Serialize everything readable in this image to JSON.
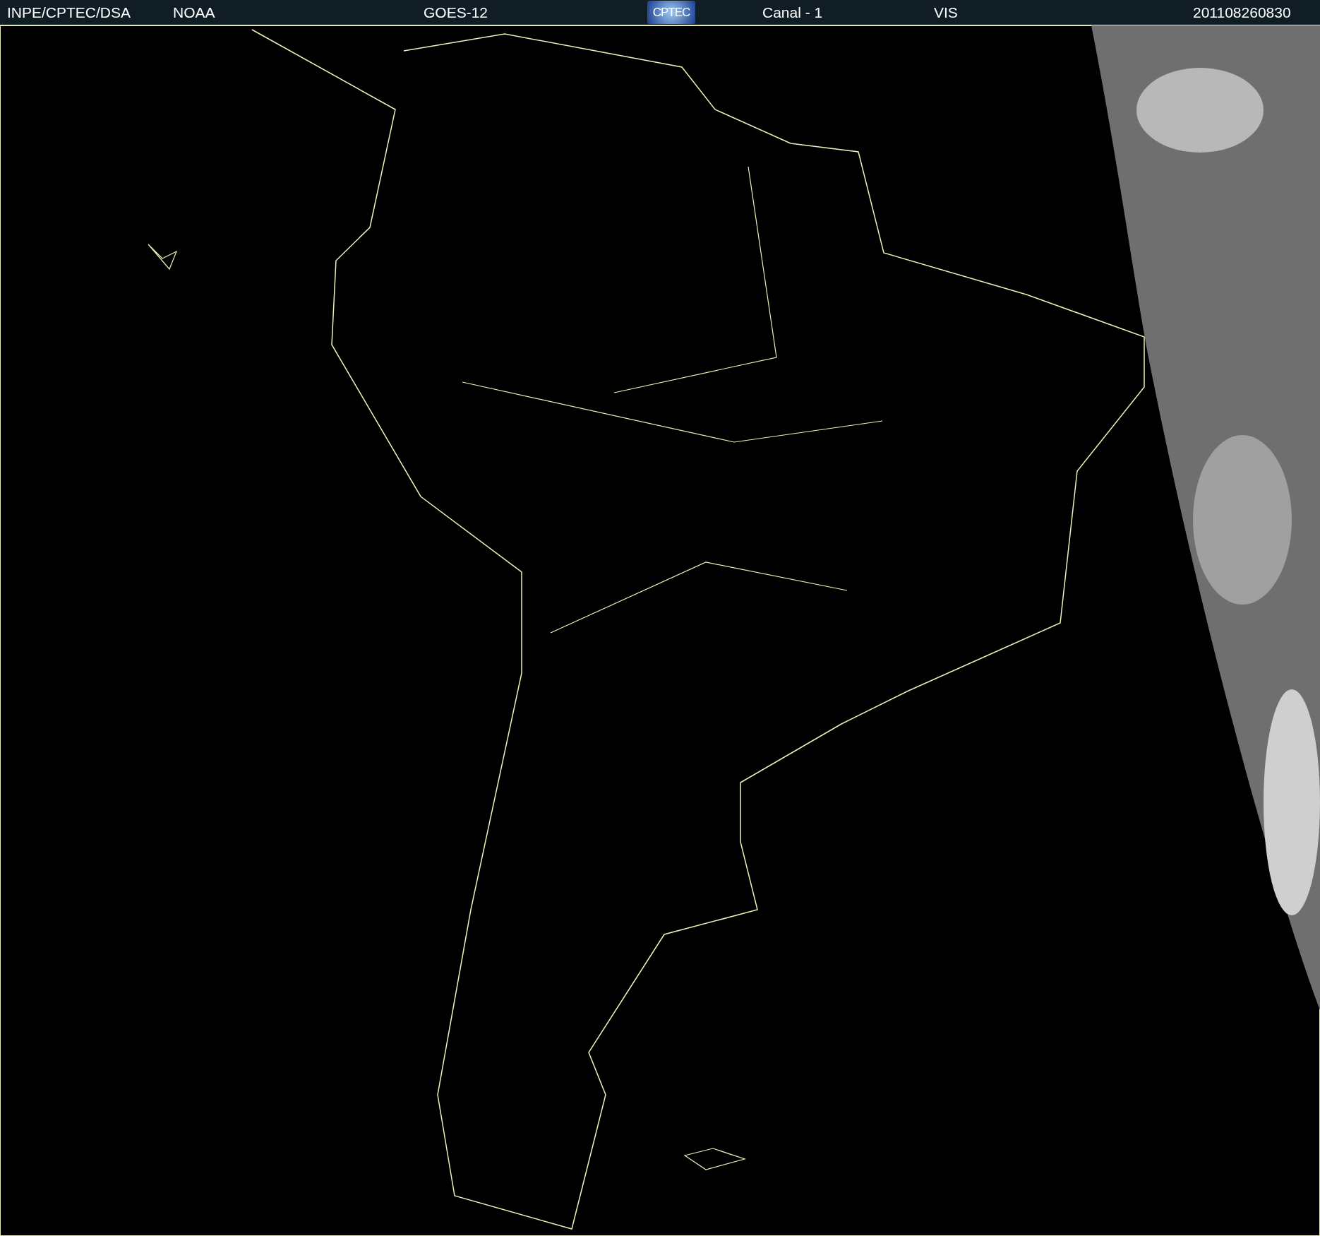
{
  "header": {
    "items": [
      {
        "kind": "text",
        "text": "INPE/CPTEC/DSA"
      },
      {
        "kind": "text",
        "text": "NOAA"
      },
      {
        "kind": "text",
        "text": "GOES-12"
      },
      {
        "kind": "logo",
        "text": "CPTEC"
      },
      {
        "kind": "text",
        "text": "Canal - 1"
      },
      {
        "kind": "text",
        "text": "VIS"
      },
      {
        "kind": "text",
        "text": "201108260830"
      }
    ]
  }
}
